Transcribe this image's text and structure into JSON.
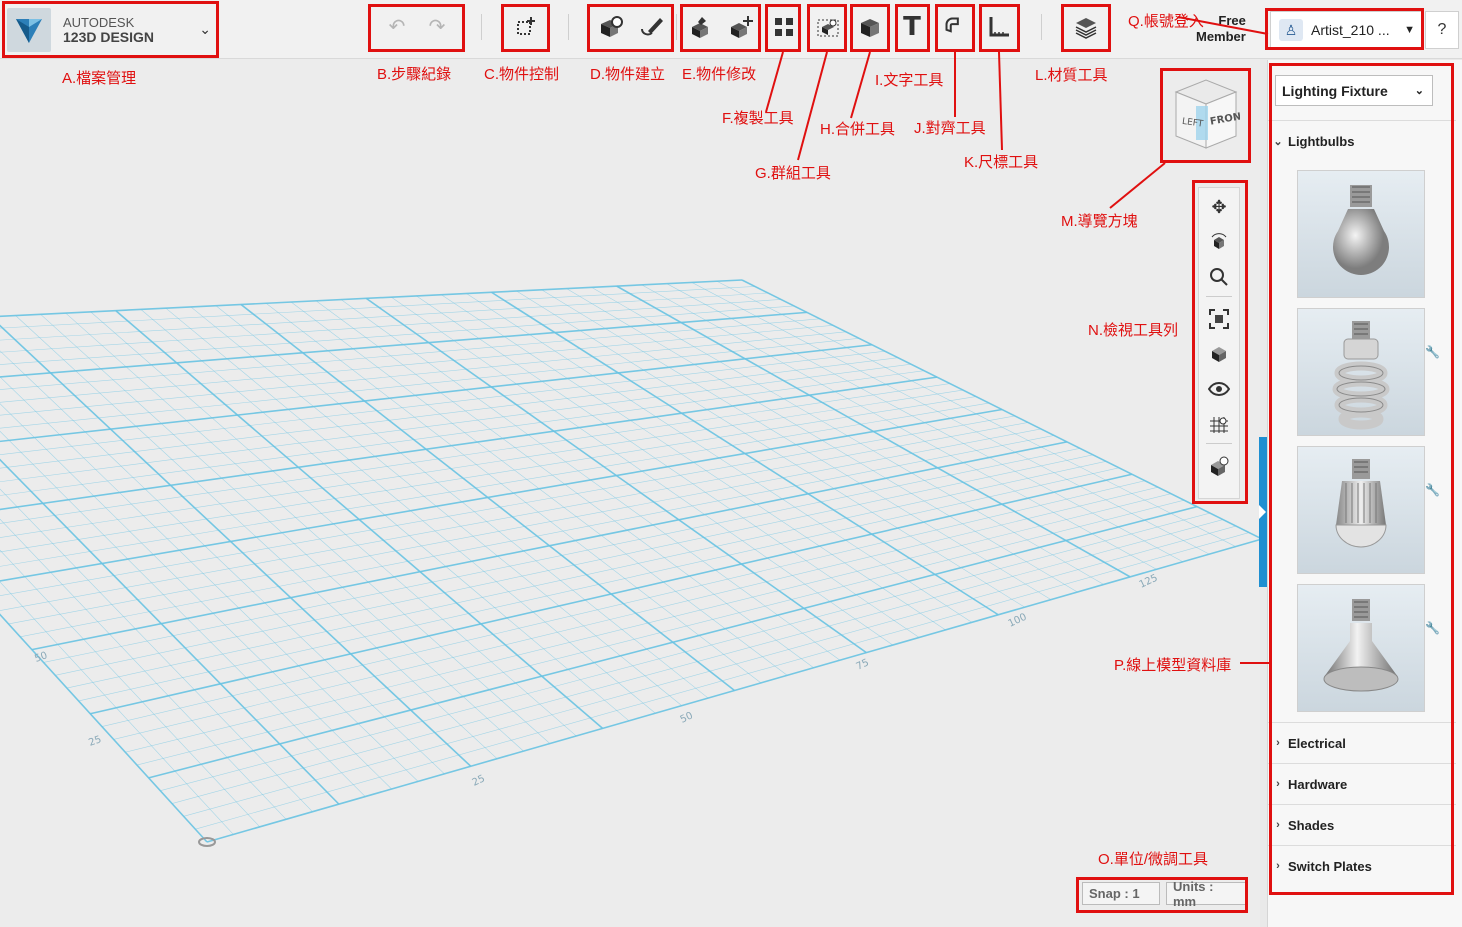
{
  "app": {
    "brand_line1": "AUTODESK",
    "brand_line2": "123D DESIGN"
  },
  "toolbar": {
    "groups": [
      "undo-redo",
      "object-control",
      "object-create",
      "object-modify",
      "duplicate",
      "group",
      "combine",
      "text",
      "snap",
      "measure",
      "material"
    ]
  },
  "account": {
    "membership": "Free Member",
    "membership_l1": "Free",
    "membership_l2": "Member",
    "username": "Artist_210 ...",
    "help_label": "?"
  },
  "annotations": {
    "A": "A.檔案管理",
    "B": "B.步驟紀錄",
    "C": "C.物件控制",
    "D": "D.物件建立",
    "E": "E.物件修改",
    "F": "F.複製工具",
    "G": "G.群組工具",
    "H": "H.合併工具",
    "I": "I.文字工具",
    "J": "J.對齊工具",
    "K": "K.尺標工具",
    "L": "L.材質工具",
    "M": "M.導覽方塊",
    "N": "N.檢視工具列",
    "O": "O.單位/微調工具",
    "P": "P.線上模型資料庫",
    "Q": "Q.帳號登入"
  },
  "navcube": {
    "left": "LEFT",
    "front": "FRONT"
  },
  "grid_labels": [
    "25",
    "50",
    "75",
    "100",
    "125",
    "25",
    "50"
  ],
  "status": {
    "snap": "Snap : 1",
    "units": "Units : mm"
  },
  "panel": {
    "category_select": "Lighting Fixture",
    "open_section": "Lightbulbs",
    "sections": [
      "Electrical",
      "Hardware",
      "Shades",
      "Switch Plates"
    ]
  },
  "colors": {
    "grid": "#69c3e3",
    "accent": "#1e8fd1",
    "annotation": "#e01010"
  }
}
